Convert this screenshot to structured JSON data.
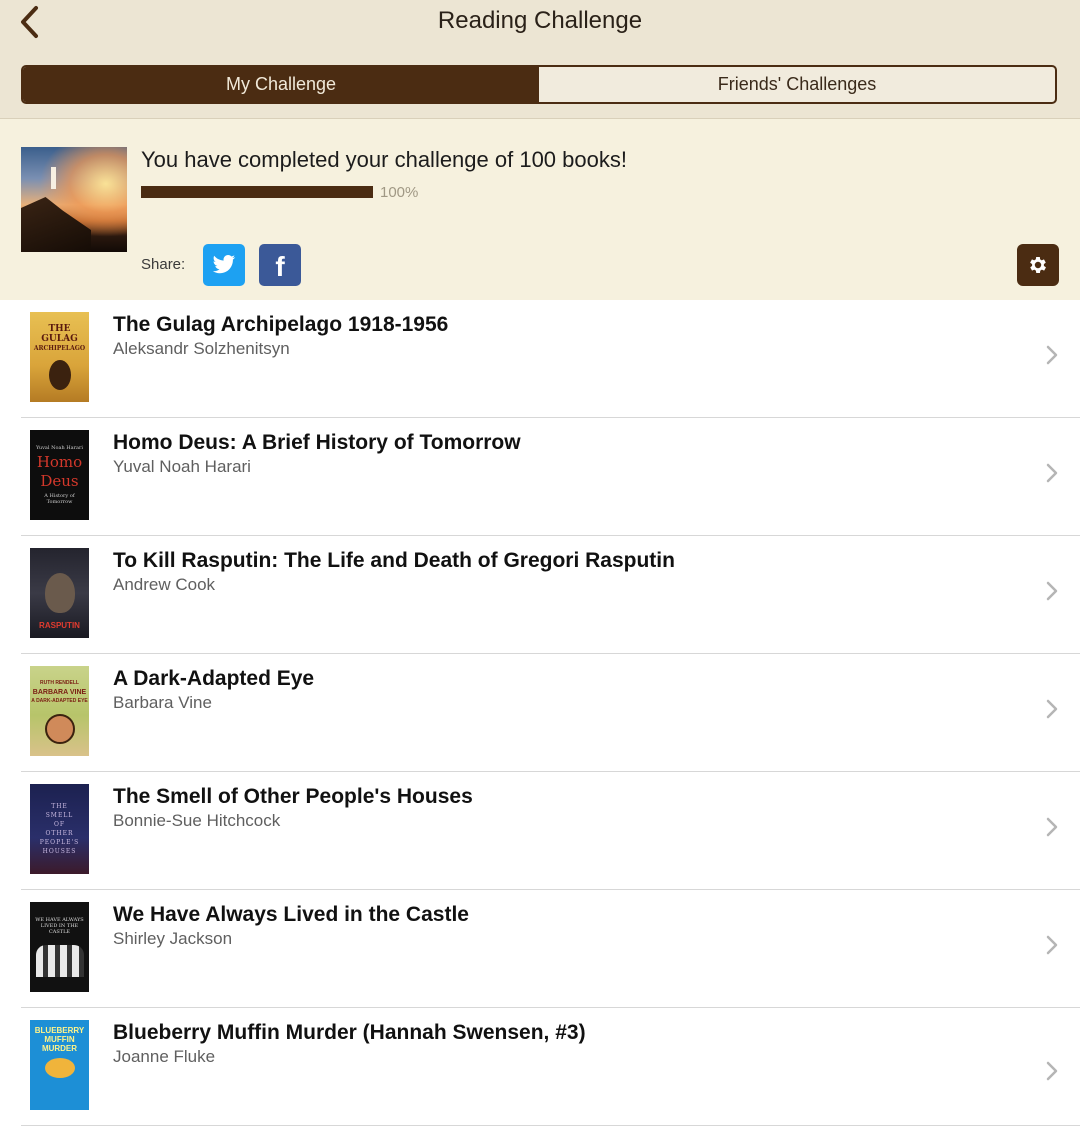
{
  "header": {
    "title": "Reading Challenge",
    "back_icon": "chevron-left-icon",
    "tabs": [
      {
        "label": "My Challenge",
        "active": true
      },
      {
        "label": "Friends' Challenges",
        "active": false
      }
    ]
  },
  "challenge": {
    "message": "You have completed your challenge of 100 books!",
    "progress_percent": 100,
    "progress_label": "100%",
    "share_label": "Share:",
    "share_buttons": [
      "twitter-icon",
      "facebook-icon"
    ],
    "settings_icon": "gear-icon"
  },
  "books": [
    {
      "title": "The Gulag Archipelago 1918-1956",
      "author": "Aleksandr Solzhenitsyn"
    },
    {
      "title": "Homo Deus: A Brief History of Tomorrow",
      "author": "Yuval Noah Harari"
    },
    {
      "title": "To Kill Rasputin: The Life and Death of Gregori Rasputin",
      "author": "Andrew Cook"
    },
    {
      "title": "A Dark-Adapted Eye",
      "author": "Barbara Vine"
    },
    {
      "title": "The Smell of Other People's Houses",
      "author": "Bonnie-Sue Hitchcock"
    },
    {
      "title": "We Have Always Lived in the Castle",
      "author": "Shirley Jackson"
    },
    {
      "title": "Blueberry Muffin Murder (Hannah Swensen, #3)",
      "author": "Joanne Fluke"
    }
  ],
  "covers": {
    "gulag": [
      "THE",
      "GULAG",
      "ARCHIPELAGO"
    ],
    "homo": {
      "top": [
        "Yuval Noah Harari"
      ],
      "title": [
        "Homo",
        "Deus"
      ],
      "sub": [
        "A History of",
        "Tomorrow"
      ]
    },
    "rasputin": "RASPUTIN",
    "dark": [
      "RUTH RENDELL",
      "BARBARA VINE",
      "A DARK-ADAPTED EYE"
    ],
    "smell": [
      "THE",
      "SMELL",
      "OF",
      "OTHER",
      "PEOPLE'S",
      "HOUSES"
    ],
    "castle": [
      "WE HAVE ALWAYS",
      "LIVED IN THE CASTLE"
    ],
    "blueberry": [
      "BLUEBERRY",
      "MUFFIN",
      "MURDER"
    ]
  },
  "colors": {
    "accent_brown": "#4b2c12",
    "header_bg": "#ece5d3",
    "summary_bg": "#f6f1de",
    "twitter": "#1da1f2",
    "facebook": "#3b5998"
  }
}
